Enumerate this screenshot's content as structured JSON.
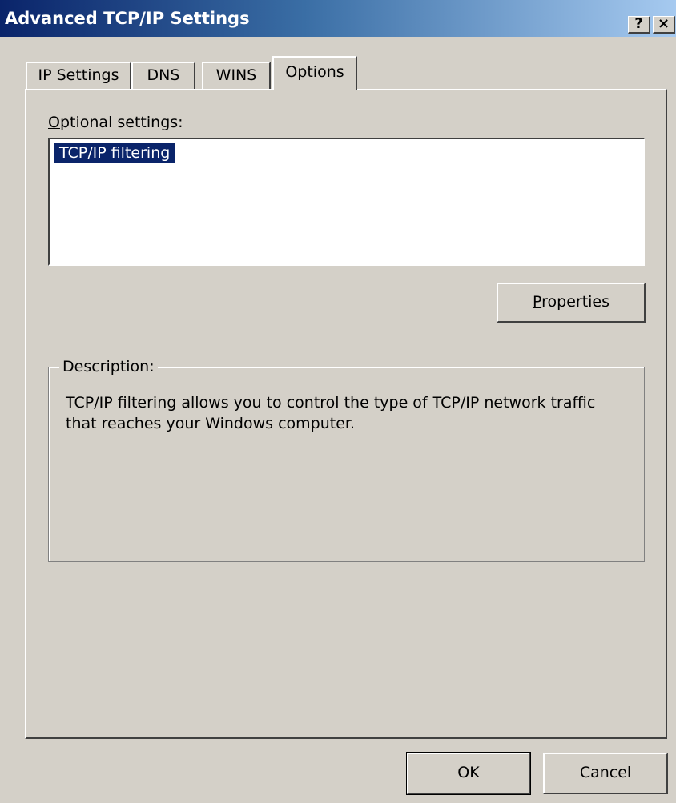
{
  "window": {
    "title": "Advanced TCP/IP Settings",
    "help_glyph": "?",
    "close_glyph": "×"
  },
  "tabs": [
    {
      "label": "IP Settings",
      "selected": false
    },
    {
      "label": "DNS",
      "selected": false
    },
    {
      "label": "WINS",
      "selected": false
    },
    {
      "label": "Options",
      "selected": true
    }
  ],
  "options": {
    "label_accel": "O",
    "label_rest": "ptional settings:",
    "items": [
      "TCP/IP filtering"
    ],
    "properties_accel": "P",
    "properties_rest": "roperties"
  },
  "description": {
    "label": "Description:",
    "text": "TCP/IP filtering allows you to control the type of TCP/IP network traffic that reaches your Windows computer."
  },
  "footer": {
    "ok_label": "OK",
    "cancel_label": "Cancel"
  },
  "colors": {
    "selection": "#0a246a",
    "face": "#d4d0c8",
    "title_start": "#0a246a",
    "title_end": "#a6caf0"
  }
}
